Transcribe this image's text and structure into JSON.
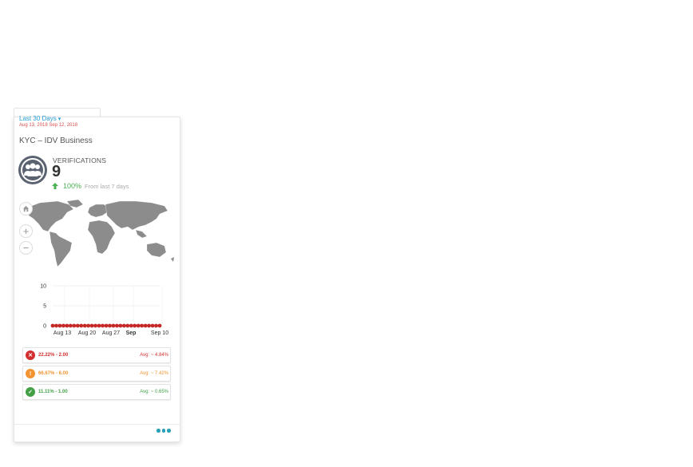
{
  "widget": {
    "range_label": "Last 30 Days",
    "date_range": "Aug 13, 2018 Sep 12, 2018",
    "title": "KYC – IDV Business",
    "icon": "users-group-icon",
    "metric": {
      "label": "VERIFICATIONS",
      "value": "9",
      "trend_icon": "arrow-up-icon",
      "trend_pct": "100%",
      "trend_text": "From last 7 days"
    }
  },
  "map": {
    "home_icon": "home-icon",
    "zoom_in": "+",
    "zoom_out": "−"
  },
  "chart_data": {
    "type": "line",
    "x_tick_labels": [
      "Aug 13",
      "Aug 20",
      "Aug 27",
      "Sep",
      "Sep 10"
    ],
    "ylim": [
      0,
      10
    ],
    "y_ticks": [
      "0",
      "5",
      "10"
    ],
    "series": [
      {
        "values": [
          0,
          0,
          0,
          0,
          0,
          0,
          0,
          0,
          0,
          0,
          0,
          0,
          0,
          0,
          0,
          0,
          0,
          0,
          0,
          0,
          0,
          0,
          0,
          0,
          0,
          0,
          0,
          0,
          0,
          0,
          0
        ],
        "color": "#c62828"
      }
    ],
    "grid": true
  },
  "stats": [
    {
      "icon": "x-circle-icon",
      "value": "22.22% - 2.00",
      "avg": "Avg: ~ 4.84%",
      "color": "#d32f2f"
    },
    {
      "icon": "warning-triangle-icon",
      "value": "66.67% - 6.00",
      "avg": "Avg: ~ 7.42%",
      "color": "#f29431"
    },
    {
      "icon": "check-circle-icon",
      "value": "11.11% - 1.00",
      "avg": "Avg: ~ 0.65%",
      "color": "#43a047"
    }
  ],
  "footer": {
    "more_icon": "more-dots-icon"
  }
}
